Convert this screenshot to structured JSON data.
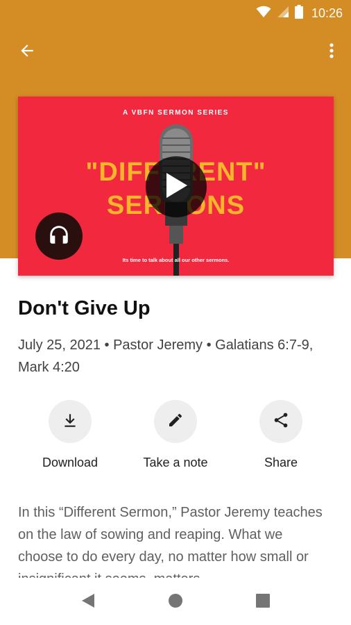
{
  "status_bar": {
    "time": "10:26",
    "icons": [
      "wifi-icon",
      "signal-icon",
      "battery-icon"
    ]
  },
  "app_bar": {
    "back_icon": "arrow-back-icon",
    "more_icon": "more-vert-icon"
  },
  "artwork": {
    "series_label": "A VBFN SERMON SERIES",
    "title_line1": "\"DIFFERENT\"",
    "title_line2": "SERMONS",
    "tagline": "Its time to talk about all our other sermons.",
    "play_icon": "play-icon",
    "audio_icon": "headphones-icon",
    "background_color": "#f2283f",
    "title_color": "#f7b52c"
  },
  "sermon": {
    "title": "Don't Give Up",
    "meta": "July 25, 2021 • Pastor Jeremy • Galatians 6:7-9, Mark 4:20",
    "description": "In this “Different Sermon,” Pastor Jeremy teaches on the law of sowing and reaping. What we choose to do every day, no matter how small or insignificant it seems, matters."
  },
  "actions": [
    {
      "label": "Download",
      "icon": "download-icon"
    },
    {
      "label": "Take a note",
      "icon": "pencil-icon"
    },
    {
      "label": "Share",
      "icon": "share-icon"
    }
  ],
  "nav_bar": {
    "icons": [
      "nav-back-icon",
      "nav-home-icon",
      "nav-recents-icon"
    ]
  },
  "colors": {
    "header_background": "#d48c24"
  }
}
